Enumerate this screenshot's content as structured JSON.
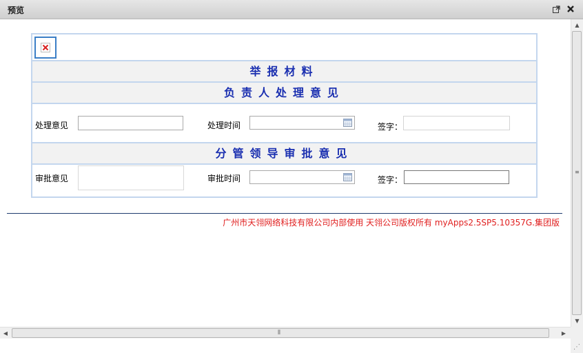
{
  "window": {
    "title": "预览",
    "popout_icon": "popout-icon",
    "close_icon": "close-icon"
  },
  "form": {
    "image_icon": "broken-image-icon",
    "section_report": "举报材料",
    "section_responsible": "负责人处理意见",
    "responsible_row": {
      "opinion_label": "处理意见",
      "opinion_value": "",
      "time_label": "处理时间",
      "time_value": "",
      "sign_label": "签字：",
      "sign_value": ""
    },
    "section_leader": "分管领导审批意见",
    "leader_row": {
      "opinion_label": "审批意见",
      "opinion_value": "",
      "time_label": "审批时间",
      "time_value": "",
      "sign_label": "签字：",
      "sign_value": ""
    }
  },
  "footer": {
    "text": "广州市天翎网络科技有限公司内部使用  天翎公司版权所有  myApps2.5SP5.10357G.集团版"
  },
  "colors": {
    "section_title": "#1a2fb0",
    "form_border": "#c3d6ee",
    "footer_text": "#e01e1e"
  }
}
